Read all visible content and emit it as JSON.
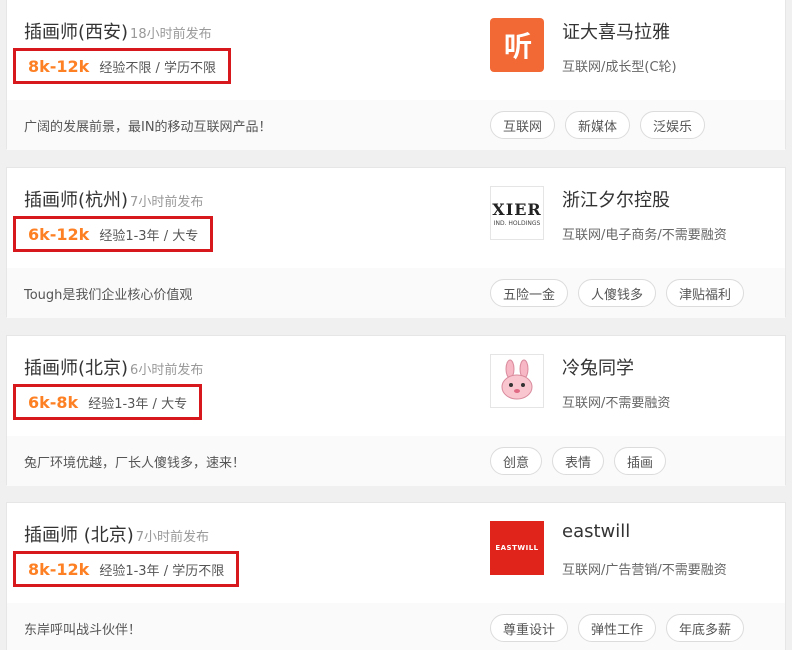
{
  "jobs": [
    {
      "title": "插画师(西安)",
      "time": "18小时前发布",
      "salary": "8k-12k",
      "requirements": "经验不限 / 学历不限",
      "description": "广阔的发展前景，最IN的移动互联网产品！",
      "company": "证大喜马拉雅",
      "industry": "互联网/成长型(C轮)",
      "logo_text": "听",
      "logo_color": "#f26935",
      "tags": [
        "互联网",
        "新媒体",
        "泛娱乐"
      ]
    },
    {
      "title": "插画师(杭州)",
      "time": "7小时前发布",
      "salary": "6k-12k",
      "requirements": "经验1-3年 / 大专",
      "description": "Tough是我们企业核心价值观",
      "company": "浙江夕尔控股",
      "industry": "互联网/电子商务/不需要融资",
      "logo_text": "XIER",
      "logo_subtext": "IND. HOLDINGS",
      "tags": [
        "五险一金",
        "人傻钱多",
        "津贴福利"
      ]
    },
    {
      "title": "插画师(北京)",
      "time": "6小时前发布",
      "salary": "6k-8k",
      "requirements": "经验1-3年 / 大专",
      "description": "兔厂环境优越，厂长人傻钱多，速来！",
      "company": "冷兔同学",
      "industry": "互联网/不需要融资",
      "logo_icon": "rabbit-icon",
      "tags": [
        "创意",
        "表情",
        "插画"
      ]
    },
    {
      "title": "插画师 (北京)",
      "time": "7小时前发布",
      "salary": "8k-12k",
      "requirements": "经验1-3年 / 学历不限",
      "description": "东岸呼叫战斗伙伴！",
      "company": "eastwill",
      "industry": "互联网/广告营销/不需要融资",
      "logo_text": "EASTWILL",
      "logo_color": "#e0241b",
      "tags": [
        "尊重设计",
        "弹性工作",
        "年底多薪"
      ]
    }
  ],
  "colors": {
    "salary": "#fd8024",
    "highlight_box": "#d7191d"
  }
}
